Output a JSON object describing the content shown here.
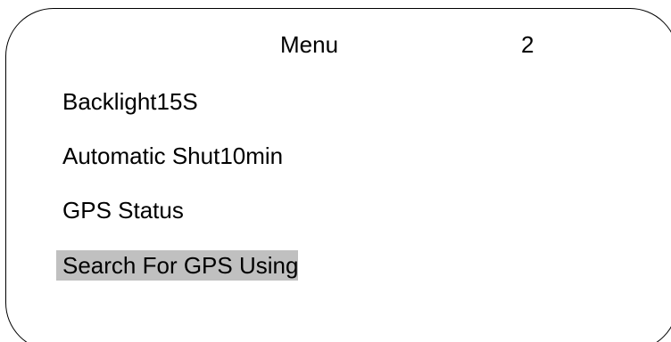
{
  "header": {
    "title": "Menu",
    "page_number": "2"
  },
  "menu": {
    "items": [
      {
        "label": "Backlight15S",
        "selected": false
      },
      {
        "label": "Automatic Shut10min",
        "selected": false
      },
      {
        "label": "GPS Status",
        "selected": false
      },
      {
        "label": "Search For GPS Using",
        "selected": true
      }
    ]
  },
  "colors": {
    "background": "#ffffff",
    "text": "#000000",
    "border": "#000000",
    "selection_highlight": "#c0c0c0"
  }
}
